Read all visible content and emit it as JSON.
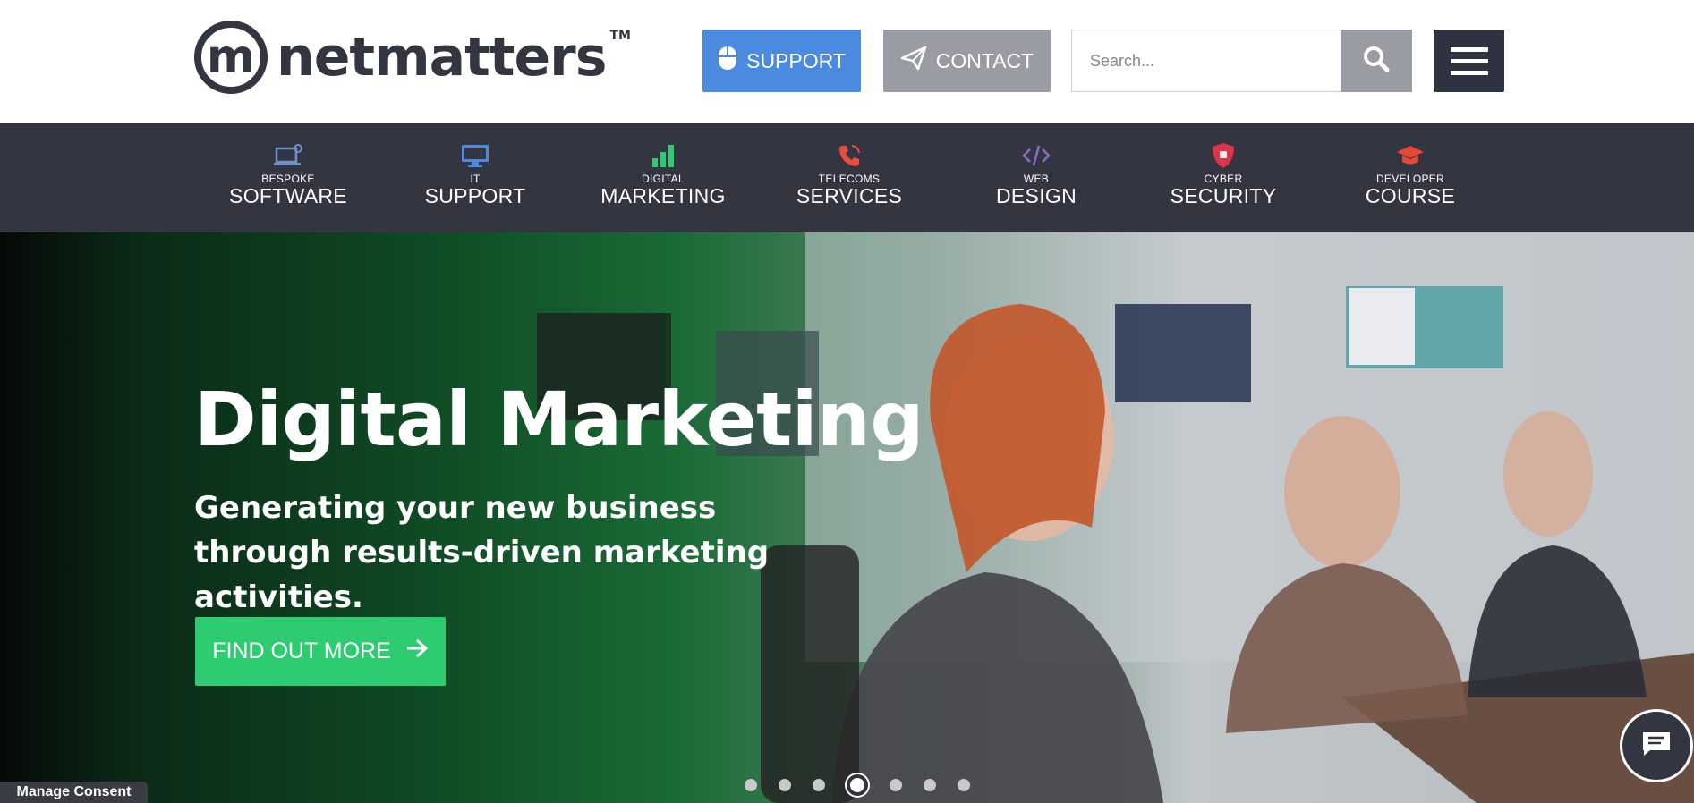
{
  "header": {
    "logo": {
      "mark": "m",
      "text": "netmatters",
      "tm": "TM"
    },
    "support_label": "SUPPORT",
    "contact_label": "CONTACT",
    "search_placeholder": "Search...",
    "icons": {
      "support": "mouse-icon",
      "contact": "paper-plane-icon",
      "search": "search-icon",
      "menu": "hamburger-menu-icon"
    }
  },
  "nav": {
    "items": [
      {
        "small": "BESPOKE",
        "big": "SOFTWARE",
        "icon": "laptop-gear-icon",
        "color": "#6f8fc9"
      },
      {
        "small": "IT",
        "big": "SUPPORT",
        "icon": "monitor-icon",
        "color": "#4a8ae0"
      },
      {
        "small": "DIGITAL",
        "big": "MARKETING",
        "icon": "bar-chart-icon",
        "color": "#2ecc71"
      },
      {
        "small": "TELECOMS",
        "big": "SERVICES",
        "icon": "phone-icon",
        "color": "#e74c3c"
      },
      {
        "small": "WEB",
        "big": "DESIGN",
        "icon": "code-icon",
        "color": "#8e6bbf"
      },
      {
        "small": "CYBER",
        "big": "SECURITY",
        "icon": "shield-icon",
        "color": "#e0334a"
      },
      {
        "small": "DEVELOPER",
        "big": "COURSE",
        "icon": "graduation-cap-icon",
        "color": "#e5473a"
      }
    ]
  },
  "hero": {
    "title": "Digital Marketing",
    "subtitle": "Generating your new business through results-driven marketing activities.",
    "cta_label": "FIND OUT MORE",
    "slide_count": 7,
    "active_slide": 3
  },
  "consent_label": "Manage Consent",
  "colors": {
    "dark": "#333640",
    "support": "#4a8ae0",
    "contact": "#9a9ca3",
    "cta": "#2ecc71"
  }
}
